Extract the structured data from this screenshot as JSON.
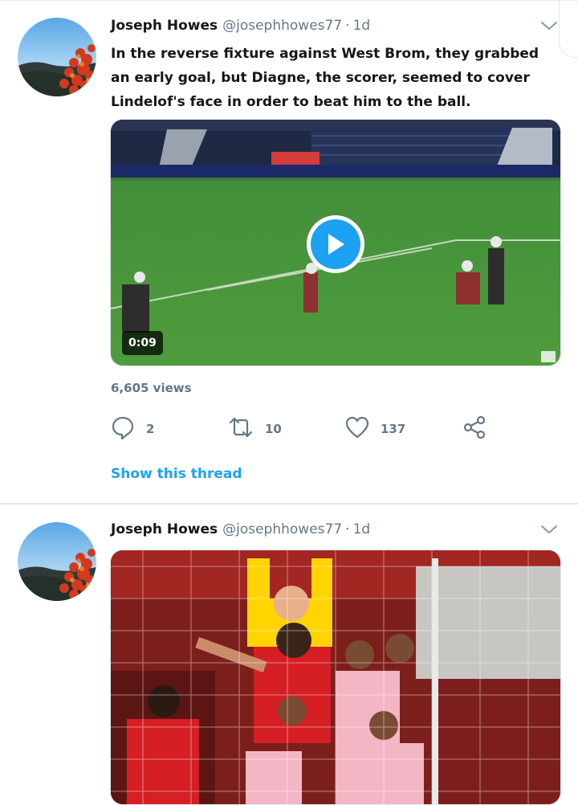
{
  "tweets": [
    {
      "display_name": "Joseph Howes",
      "handle": "@josephhowes77",
      "separator": "·",
      "time": "1d",
      "text": "In the reverse fixture against West Brom, they grabbed an early goal, but Diagne, the scorer, seemed to cover Lindelof's face in order to beat him to the ball.",
      "media": {
        "type": "video",
        "duration": "0:09"
      },
      "views": "6,605 views",
      "actions": {
        "reply_count": "2",
        "retweet_count": "10",
        "like_count": "137"
      },
      "show_thread": "Show this thread"
    },
    {
      "display_name": "Joseph Howes",
      "handle": "@josephhowes77",
      "separator": "·",
      "time": "1d",
      "media": {
        "type": "image"
      }
    }
  ],
  "icons": {
    "more": "chevron-down-icon",
    "reply": "reply-icon",
    "retweet": "retweet-icon",
    "like": "heart-icon",
    "share": "share-icon",
    "play": "play-icon"
  },
  "colors": {
    "accent": "#1da1f2",
    "secondary_text": "#657786",
    "primary_text": "#14171a",
    "divider": "#e1e8ed"
  }
}
